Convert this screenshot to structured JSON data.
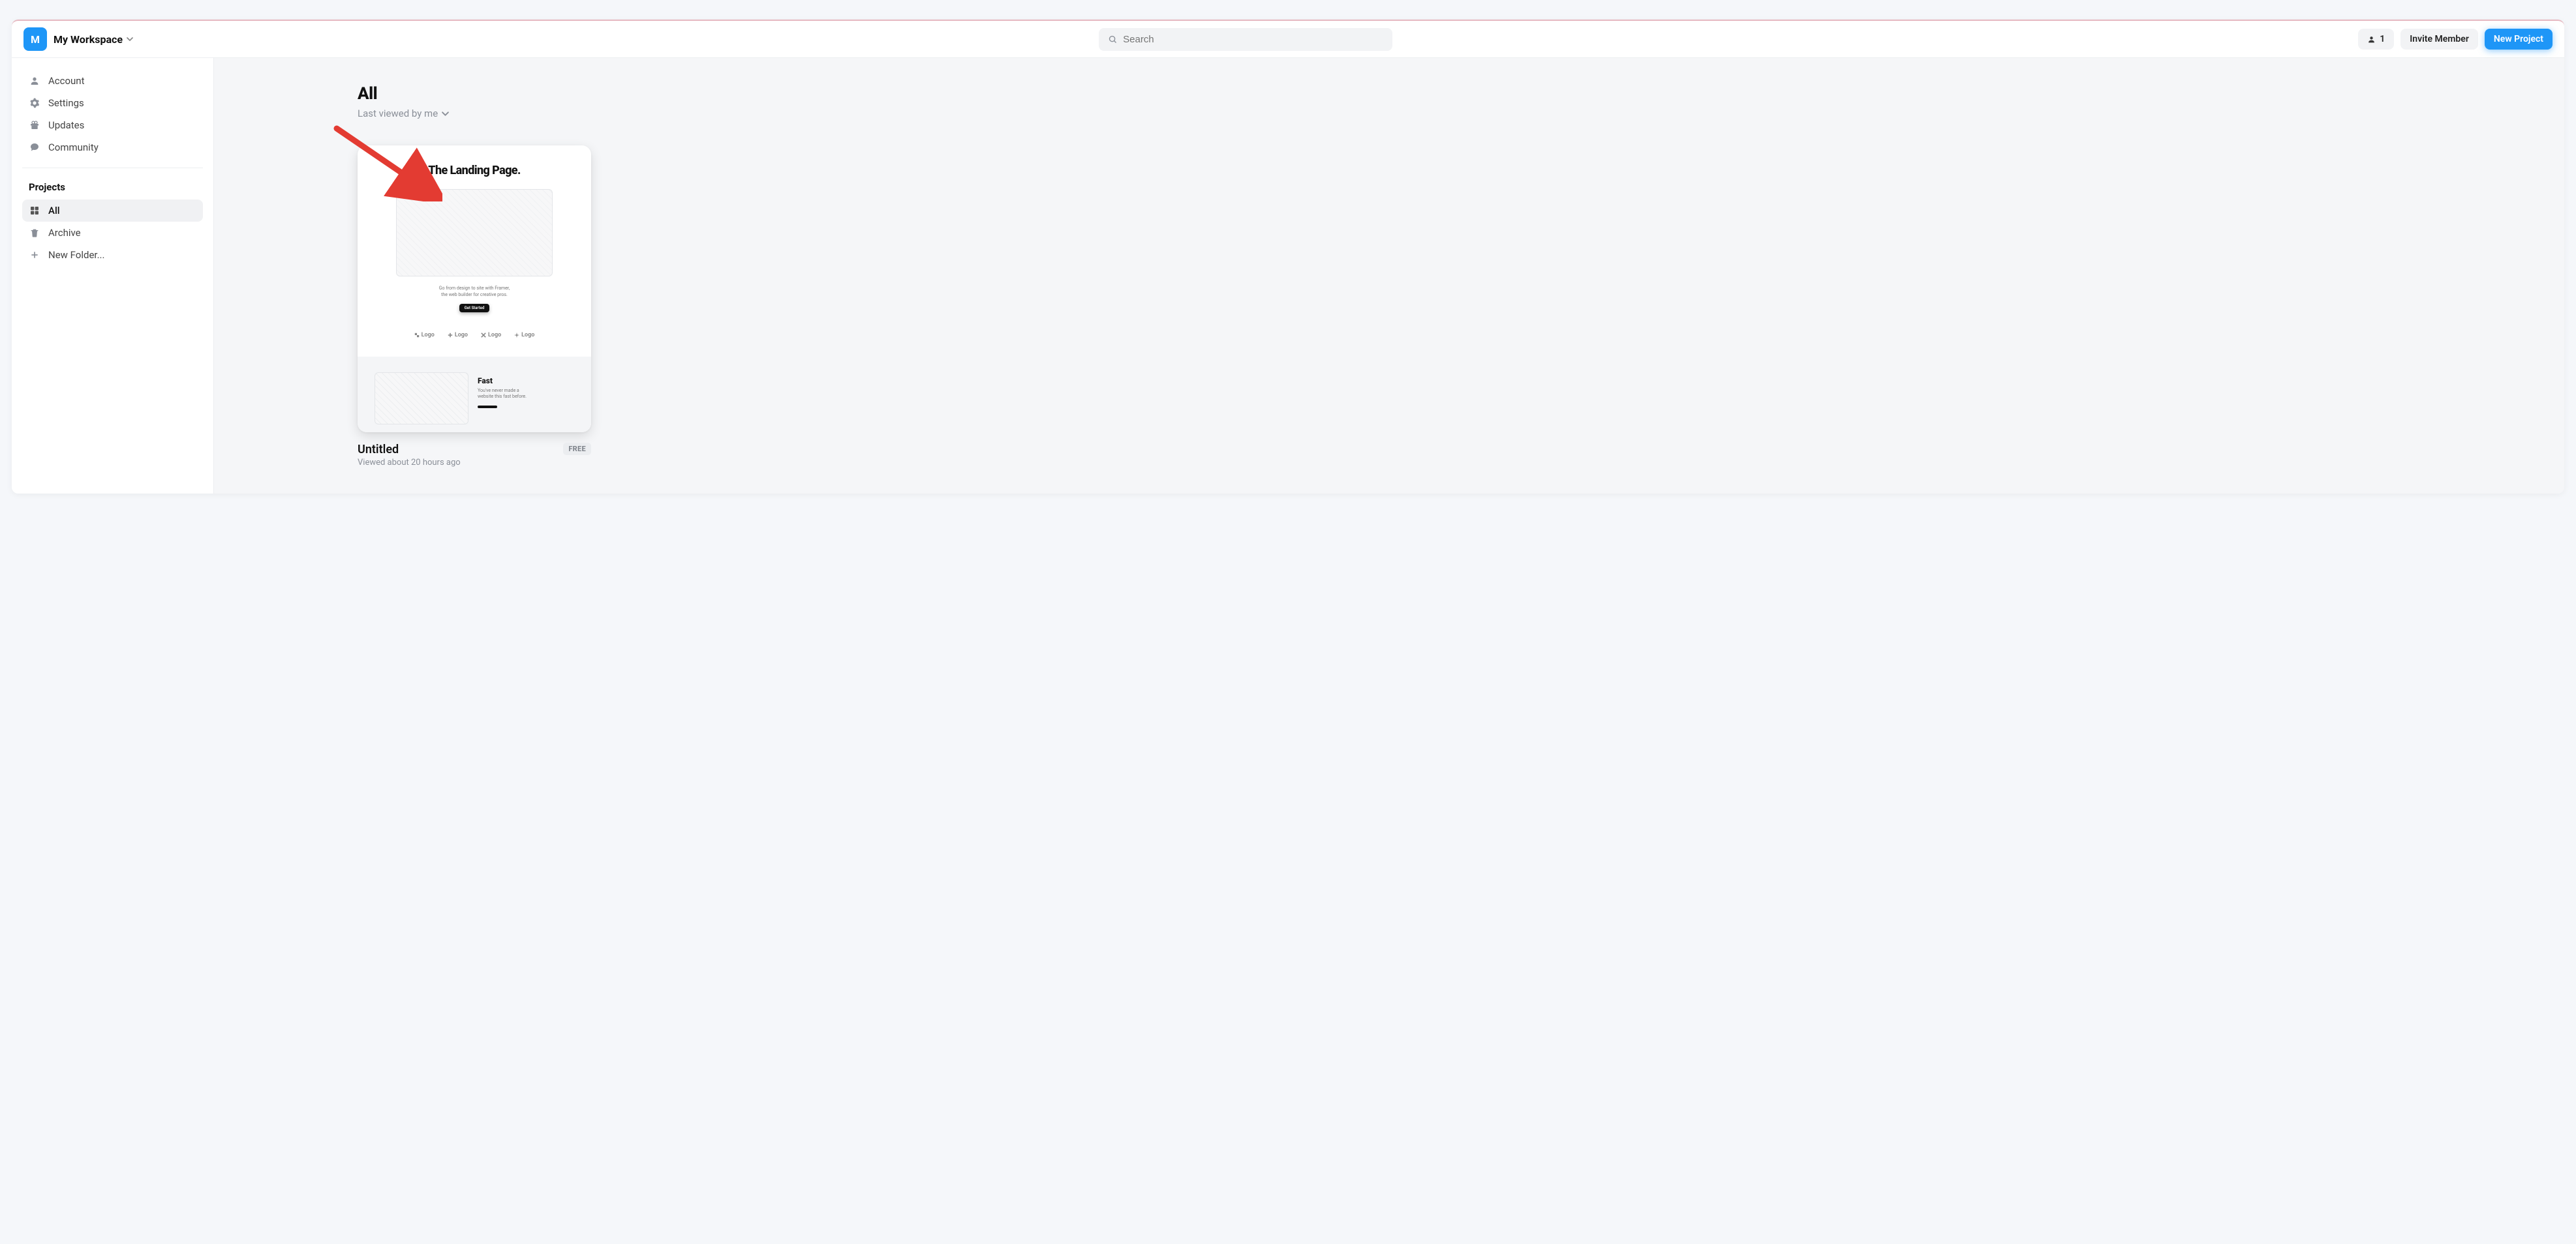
{
  "workspace": {
    "logo_letter": "M",
    "name": "My Workspace"
  },
  "search": {
    "placeholder": "Search"
  },
  "header_actions": {
    "member_count": "1",
    "invite_label": "Invite Member",
    "new_project_label": "New Project"
  },
  "sidebar": {
    "items": [
      {
        "id": "account",
        "label": "Account"
      },
      {
        "id": "settings",
        "label": "Settings"
      },
      {
        "id": "updates",
        "label": "Updates"
      },
      {
        "id": "community",
        "label": "Community"
      }
    ],
    "projects_heading": "Projects",
    "project_items": [
      {
        "id": "all",
        "label": "All",
        "active": true
      },
      {
        "id": "archive",
        "label": "Archive"
      },
      {
        "id": "new-folder",
        "label": "New Folder..."
      }
    ]
  },
  "main": {
    "title": "All",
    "sort_label": "Last viewed by me"
  },
  "projects": [
    {
      "title": "Untitled",
      "subtitle": "Viewed about 20 hours ago",
      "badge": "FREE",
      "thumb": {
        "heading": "The Landing Page.",
        "subline1": "Go from design to site with Framer,",
        "subline2": "the web builder for creative pros.",
        "cta": "Get Started",
        "logo": "Logo",
        "feature_heading": "Fast",
        "feature_line1": "You've never made a",
        "feature_line2": "website this fast before."
      }
    }
  ]
}
